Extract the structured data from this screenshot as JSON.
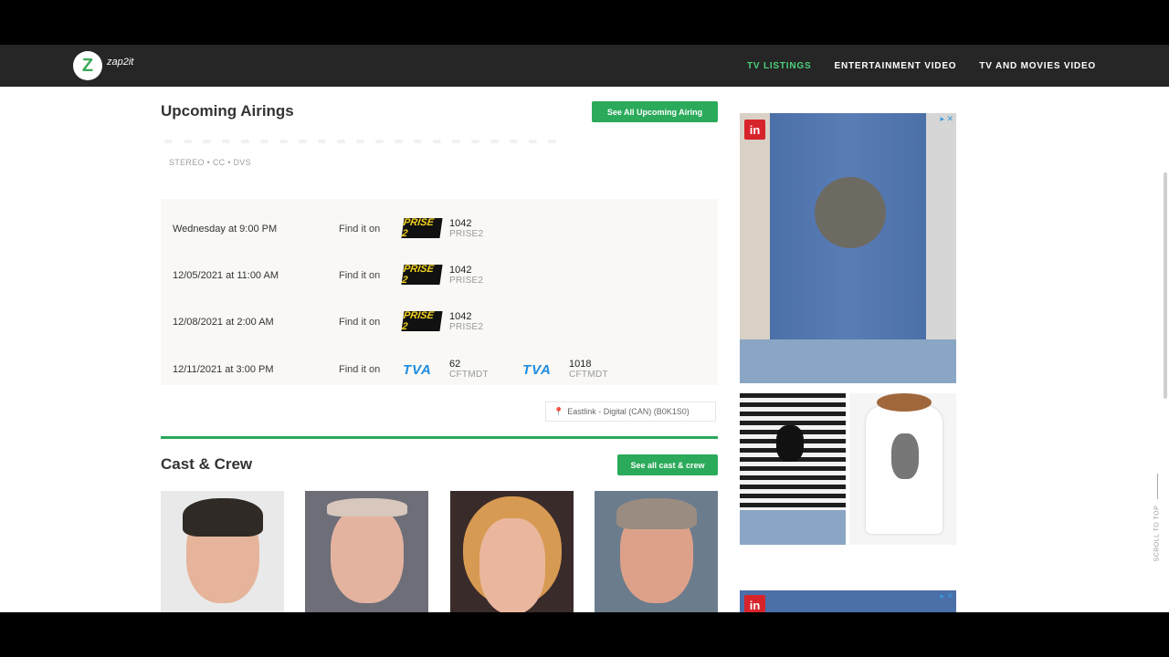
{
  "nav": {
    "logo_letter": "Z",
    "logo_text": "zap2it",
    "links": [
      {
        "label": "TV LISTINGS",
        "active": true
      },
      {
        "label": "ENTERTAINMENT VIDEO",
        "active": false
      },
      {
        "label": "TV AND MOVIES VIDEO",
        "active": false
      }
    ]
  },
  "airings": {
    "title": "Upcoming Airings",
    "see_all_label": "See All Upcoming Airing",
    "meta": "STEREO • CC • DVS",
    "find_label": "Find it on",
    "rows": [
      {
        "time": "Wednesday at 9:00 PM",
        "channels": [
          {
            "logo": "PRISE 2",
            "type": "prise",
            "number": "1042",
            "name": "PRISE2"
          }
        ]
      },
      {
        "time": "12/05/2021 at 11:00 AM",
        "channels": [
          {
            "logo": "PRISE 2",
            "type": "prise",
            "number": "1042",
            "name": "PRISE2"
          }
        ]
      },
      {
        "time": "12/08/2021 at 2:00 AM",
        "channels": [
          {
            "logo": "PRISE 2",
            "type": "prise",
            "number": "1042",
            "name": "PRISE2"
          }
        ]
      },
      {
        "time": "12/11/2021 at 3:00 PM",
        "channels": [
          {
            "logo": "TVA",
            "type": "tva",
            "number": "62",
            "name": "CFTMDT"
          },
          {
            "logo": "TVA",
            "type": "tva",
            "number": "1018",
            "name": "CFTMDT"
          }
        ]
      }
    ],
    "provider": "Eastlink - Digital (CAN) (B0K1S0)"
  },
  "cast": {
    "title": "Cast & Crew",
    "see_all_label": "See all cast & crew",
    "members": [
      {
        "bg": "#e9e9e9",
        "skin": "#e5b49a",
        "hair": "#2f2a25"
      },
      {
        "bg": "#6d6e78",
        "skin": "#e3b3a0",
        "hair": "#d7c7bd"
      },
      {
        "bg": "#3a2b2b",
        "skin": "#eab79e",
        "hair": "#d79a52"
      },
      {
        "bg": "#6b7c8c",
        "skin": "#dda18a",
        "hair": "#9a8c80"
      }
    ]
  },
  "ads": {
    "badge": "in",
    "close": "▸ ✕"
  },
  "scroll_top_label": "SCROLL TO TOP",
  "colors": {
    "accent_green": "#2aaa5a",
    "nav_active": "#4cd17a",
    "tva_blue": "#1f8de3",
    "prise_yellow": "#f2d21f"
  }
}
